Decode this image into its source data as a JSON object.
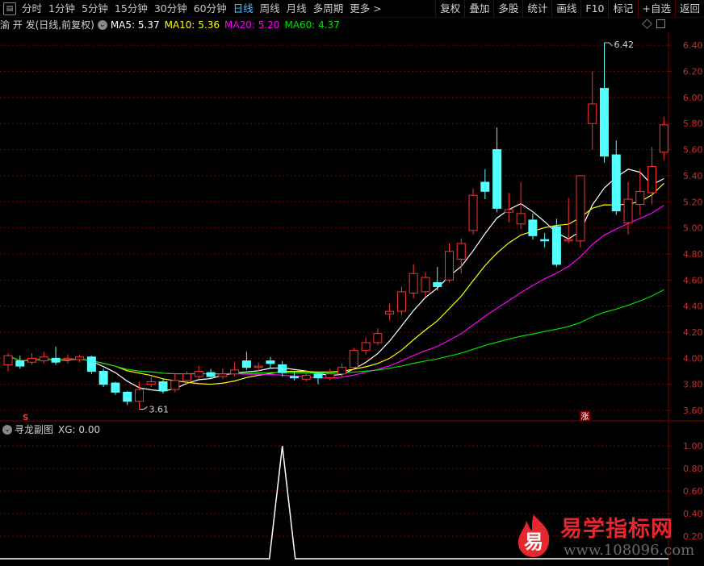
{
  "toolbar": {
    "periods": [
      "分时",
      "1分钟",
      "5分钟",
      "15分钟",
      "30分钟",
      "60分钟",
      "日线",
      "周线",
      "月线",
      "多周期",
      "更多 >"
    ],
    "active_period": "日线",
    "tools": [
      "复权",
      "叠加",
      "多股",
      "统计",
      "画线",
      "F10",
      "标记",
      "+自选",
      "返回"
    ]
  },
  "info": {
    "stock": "渝 开 发(日线,前复权)",
    "ma": [
      {
        "label": "MA5: 5.37",
        "color": "#ffffff"
      },
      {
        "label": "MA10: 5.36",
        "color": "#ffff00"
      },
      {
        "label": "MA20: 5.20",
        "color": "#ff00ff"
      },
      {
        "label": "MA60: 4.37",
        "color": "#00e000"
      }
    ]
  },
  "sub": {
    "title": "寻龙副图",
    "value": "XG: 0.00"
  },
  "price_axis": {
    "ticks": [
      "6.40",
      "6.20",
      "6.00",
      "5.80",
      "5.60",
      "5.40",
      "5.20",
      "5.00",
      "4.80",
      "4.60",
      "4.40",
      "4.20",
      "4.00",
      "3.80",
      "3.60"
    ],
    "tick_values": [
      6.4,
      6.2,
      6.0,
      5.8,
      5.6,
      5.4,
      5.2,
      5.0,
      4.8,
      4.6,
      4.4,
      4.2,
      4.0,
      3.8,
      3.6
    ]
  },
  "sub_axis": {
    "ticks": [
      "1.00",
      "0.80",
      "0.60",
      "0.40",
      "0.20"
    ],
    "tick_values": [
      1.0,
      0.8,
      0.6,
      0.4,
      0.2
    ]
  },
  "annotations": {
    "high": "6.42",
    "low": "3.61",
    "zhang": "涨",
    "s_marker": "S"
  },
  "watermark": {
    "title": "易学指标网",
    "url": "www.108096.com",
    "logo_char": "易"
  },
  "colors": {
    "up": "#ff3232",
    "down": "#54ffff",
    "grid": "#7a0000",
    "axis_text": "#d22a2a"
  },
  "chart_data": {
    "type": "candlestick",
    "ylim": [
      3.52,
      6.5
    ],
    "candles": [
      [
        3.95,
        4.02,
        4.04,
        3.9
      ],
      [
        3.98,
        3.94,
        4.02,
        3.92
      ],
      [
        3.97,
        4.0,
        4.04,
        3.95
      ],
      [
        3.98,
        4.01,
        4.05,
        3.96
      ],
      [
        4.0,
        3.97,
        4.09,
        3.95
      ],
      [
        3.99,
        4.0,
        4.03,
        3.96
      ],
      [
        3.99,
        4.01,
        4.03,
        3.97
      ],
      [
        4.01,
        3.9,
        4.02,
        3.88
      ],
      [
        3.9,
        3.8,
        3.92,
        3.78
      ],
      [
        3.81,
        3.74,
        3.82,
        3.72
      ],
      [
        3.74,
        3.67,
        3.75,
        3.64
      ],
      [
        3.67,
        3.76,
        3.82,
        3.61
      ],
      [
        3.8,
        3.82,
        3.86,
        3.78
      ],
      [
        3.82,
        3.75,
        3.84,
        3.73
      ],
      [
        3.76,
        3.83,
        3.88,
        3.74
      ],
      [
        3.83,
        3.88,
        3.9,
        3.8
      ],
      [
        3.86,
        3.9,
        3.94,
        3.84
      ],
      [
        3.89,
        3.86,
        3.92,
        3.84
      ],
      [
        3.86,
        3.88,
        3.92,
        3.84
      ],
      [
        3.88,
        3.91,
        3.97,
        3.86
      ],
      [
        3.98,
        3.93,
        4.05,
        3.91
      ],
      [
        3.93,
        3.94,
        3.97,
        3.9
      ],
      [
        3.98,
        3.96,
        4.01,
        3.92
      ],
      [
        3.95,
        3.89,
        3.98,
        3.86
      ],
      [
        3.86,
        3.85,
        3.9,
        3.83
      ],
      [
        3.84,
        3.87,
        3.91,
        3.82
      ],
      [
        3.88,
        3.85,
        3.9,
        3.8
      ],
      [
        3.85,
        3.88,
        3.92,
        3.83
      ],
      [
        3.88,
        3.93,
        3.96,
        3.86
      ],
      [
        3.93,
        4.06,
        4.08,
        3.92
      ],
      [
        4.06,
        4.12,
        4.16,
        4.03
      ],
      [
        4.12,
        4.19,
        4.23,
        4.1
      ],
      [
        4.34,
        4.36,
        4.42,
        4.29
      ],
      [
        4.36,
        4.51,
        4.55,
        4.33
      ],
      [
        4.5,
        4.65,
        4.72,
        4.46
      ],
      [
        4.51,
        4.62,
        4.66,
        4.47
      ],
      [
        4.58,
        4.55,
        4.7,
        4.52
      ],
      [
        4.6,
        4.82,
        4.88,
        4.58
      ],
      [
        4.76,
        4.88,
        4.92,
        4.65
      ],
      [
        4.98,
        5.25,
        5.3,
        4.95
      ],
      [
        5.35,
        5.28,
        5.45,
        5.22
      ],
      [
        5.6,
        5.15,
        5.77,
        5.12
      ],
      [
        5.12,
        5.14,
        5.27,
        5.04
      ],
      [
        5.03,
        5.11,
        5.35,
        4.99
      ],
      [
        5.06,
        4.94,
        5.11,
        4.91
      ],
      [
        4.91,
        4.9,
        4.96,
        4.85
      ],
      [
        5.01,
        4.72,
        5.07,
        4.7
      ],
      [
        4.9,
        4.91,
        5.23,
        4.88
      ],
      [
        4.9,
        5.4,
        5.4,
        4.85
      ],
      [
        5.8,
        5.95,
        6.2,
        5.6
      ],
      [
        6.07,
        5.55,
        6.42,
        5.5
      ],
      [
        5.56,
        5.13,
        5.67,
        5.1
      ],
      [
        5.04,
        5.22,
        5.35,
        4.95
      ],
      [
        5.18,
        5.28,
        5.45,
        5.1
      ],
      [
        5.27,
        5.47,
        5.62,
        5.18
      ],
      [
        5.58,
        5.79,
        5.85,
        5.52
      ]
    ]
  }
}
